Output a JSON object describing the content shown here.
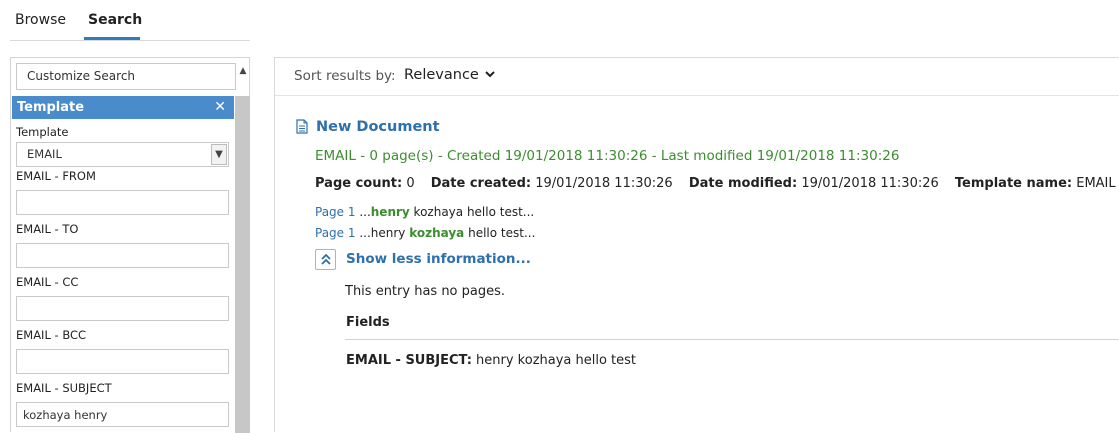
{
  "tabs": [
    {
      "label": "Browse",
      "active": false
    },
    {
      "label": "Search",
      "active": true
    }
  ],
  "left_panel": {
    "customize_label": "Customize Search",
    "section_title": "Template",
    "template_field": {
      "label": "Template",
      "value": "EMAIL"
    },
    "fields": [
      {
        "label": "EMAIL - FROM",
        "value": ""
      },
      {
        "label": "EMAIL - TO",
        "value": ""
      },
      {
        "label": "EMAIL - CC",
        "value": ""
      },
      {
        "label": "EMAIL - BCC",
        "value": ""
      },
      {
        "label": "EMAIL - SUBJECT",
        "value": "kozhaya henry"
      }
    ]
  },
  "results": {
    "sort_label": "Sort results by:",
    "sort_value": "Relevance",
    "document": {
      "title": "New Document",
      "meta": "EMAIL - 0 page(s) - Created 19/01/2018 11:30:26 - Last modified 19/01/2018 11:30:26",
      "props": [
        {
          "name": "Page count:",
          "value": "0"
        },
        {
          "name": "Date created:",
          "value": "19/01/2018 11:30:26"
        },
        {
          "name": "Date modified:",
          "value": "19/01/2018 11:30:26"
        },
        {
          "name": "Template name:",
          "value": "EMAIL"
        }
      ],
      "hits": [
        {
          "page": "Page 1",
          "pre": " ...",
          "highlight": "henry",
          "post": " kozhaya hello test..."
        },
        {
          "page": "Page 1",
          "pre": " ...henry ",
          "highlight": "kozhaya",
          "post": " hello test..."
        }
      ],
      "toggle_label": "Show less information...",
      "no_pages_text": "This entry has no pages.",
      "fields_heading": "Fields",
      "field_entries": [
        {
          "name": "EMAIL - SUBJECT:",
          "value": " henry kozhaya hello test"
        }
      ]
    }
  },
  "colors": {
    "accent": "#2e7bbf",
    "header_blue": "#4a8ccb",
    "link_blue": "#2e6fad",
    "meta_green": "#3c8d2f"
  },
  "icons": {
    "close": "close-icon",
    "dropdown": "chevron-down-icon",
    "document": "document-icon",
    "collapse": "double-chevron-up-icon"
  }
}
